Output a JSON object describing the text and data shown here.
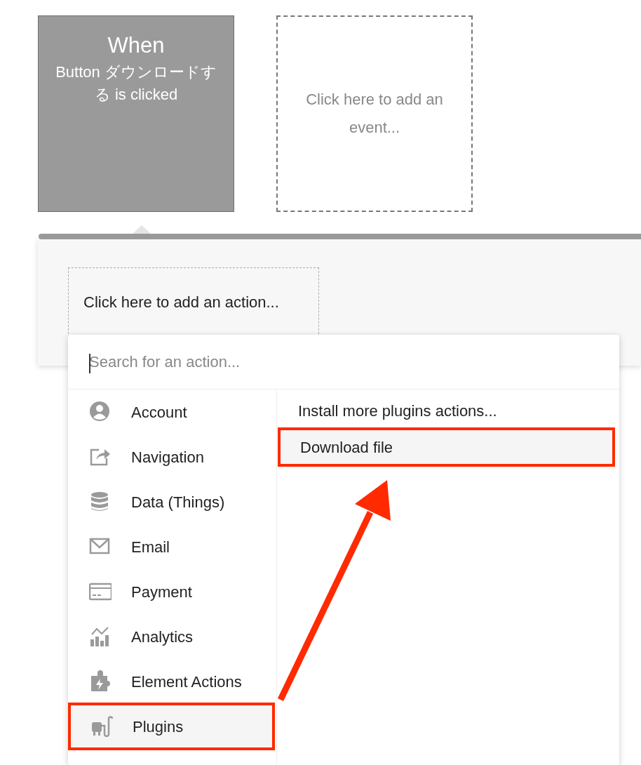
{
  "events": [
    {
      "kind": "event",
      "title": "When",
      "description": "Button ダウンロードする is clicked"
    },
    {
      "kind": "placeholder",
      "description": "Click here to add an event..."
    }
  ],
  "action_placeholder": "Click here to add an action...",
  "action_menu": {
    "search": {
      "placeholder": "Search for an action..."
    },
    "categories": [
      {
        "label": "Account",
        "selected": false
      },
      {
        "label": "Navigation",
        "selected": false
      },
      {
        "label": "Data (Things)",
        "selected": false
      },
      {
        "label": "Email",
        "selected": false
      },
      {
        "label": "Payment",
        "selected": false
      },
      {
        "label": "Analytics",
        "selected": false
      },
      {
        "label": "Element Actions",
        "selected": false
      },
      {
        "label": "Plugins",
        "selected": true
      }
    ],
    "actions": [
      {
        "label": "Install more plugins actions...",
        "selected": false
      },
      {
        "label": "Download file",
        "selected": true
      }
    ]
  }
}
